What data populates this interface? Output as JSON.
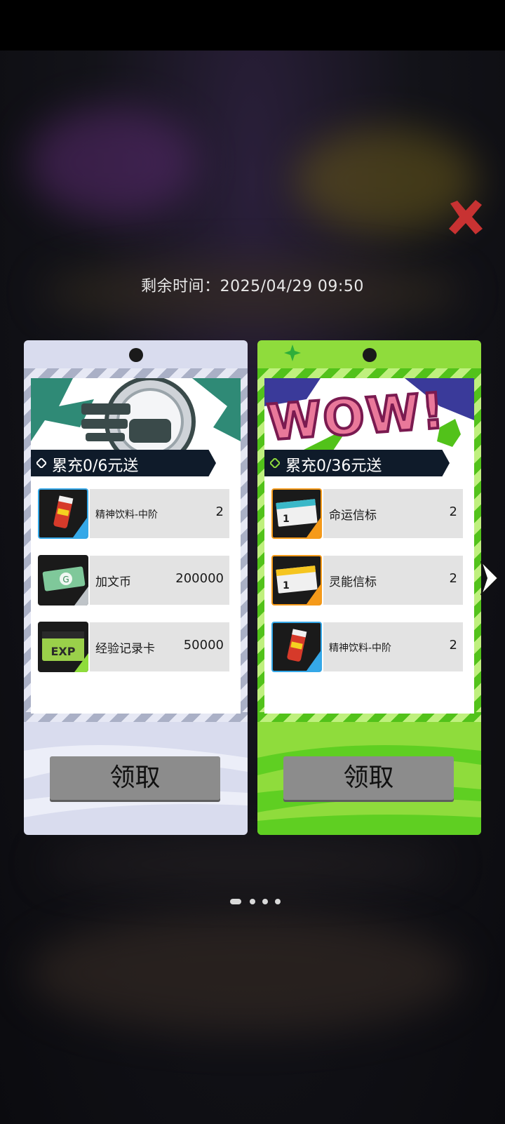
{
  "timer": {
    "text": "剩余时间：2025/04/29 09:50"
  },
  "close_icon": "close-icon",
  "cards": [
    {
      "title": "累充0/6元送",
      "theme": "#d9dcee",
      "items": [
        {
          "name": "精神饮料-中阶",
          "qty": "2",
          "icon": "energy-drink-icon"
        },
        {
          "name": "加文币",
          "qty": "200000",
          "icon": "currency-ticket-icon"
        },
        {
          "name": "经验记录卡",
          "qty": "50000",
          "icon": "exp-card-icon"
        }
      ],
      "claim_label": "领取"
    },
    {
      "title": "累充0/36元送",
      "theme": "#8fdc3c",
      "banner_text": "WOW!",
      "items": [
        {
          "name": "命运信标",
          "qty": "2",
          "icon": "fate-beacon-icon"
        },
        {
          "name": "灵能信标",
          "qty": "2",
          "icon": "psionic-beacon-icon"
        },
        {
          "name": "精神饮料-中阶",
          "qty": "2",
          "icon": "energy-drink-icon"
        }
      ],
      "claim_label": "领取"
    }
  ],
  "pagination": {
    "total": 4,
    "active": 1
  },
  "colors": {
    "accent_green": "#8fdc3c",
    "accent_lavender": "#d9dcee",
    "close_red": "#c83232",
    "button_gray": "#8c8c8c"
  }
}
